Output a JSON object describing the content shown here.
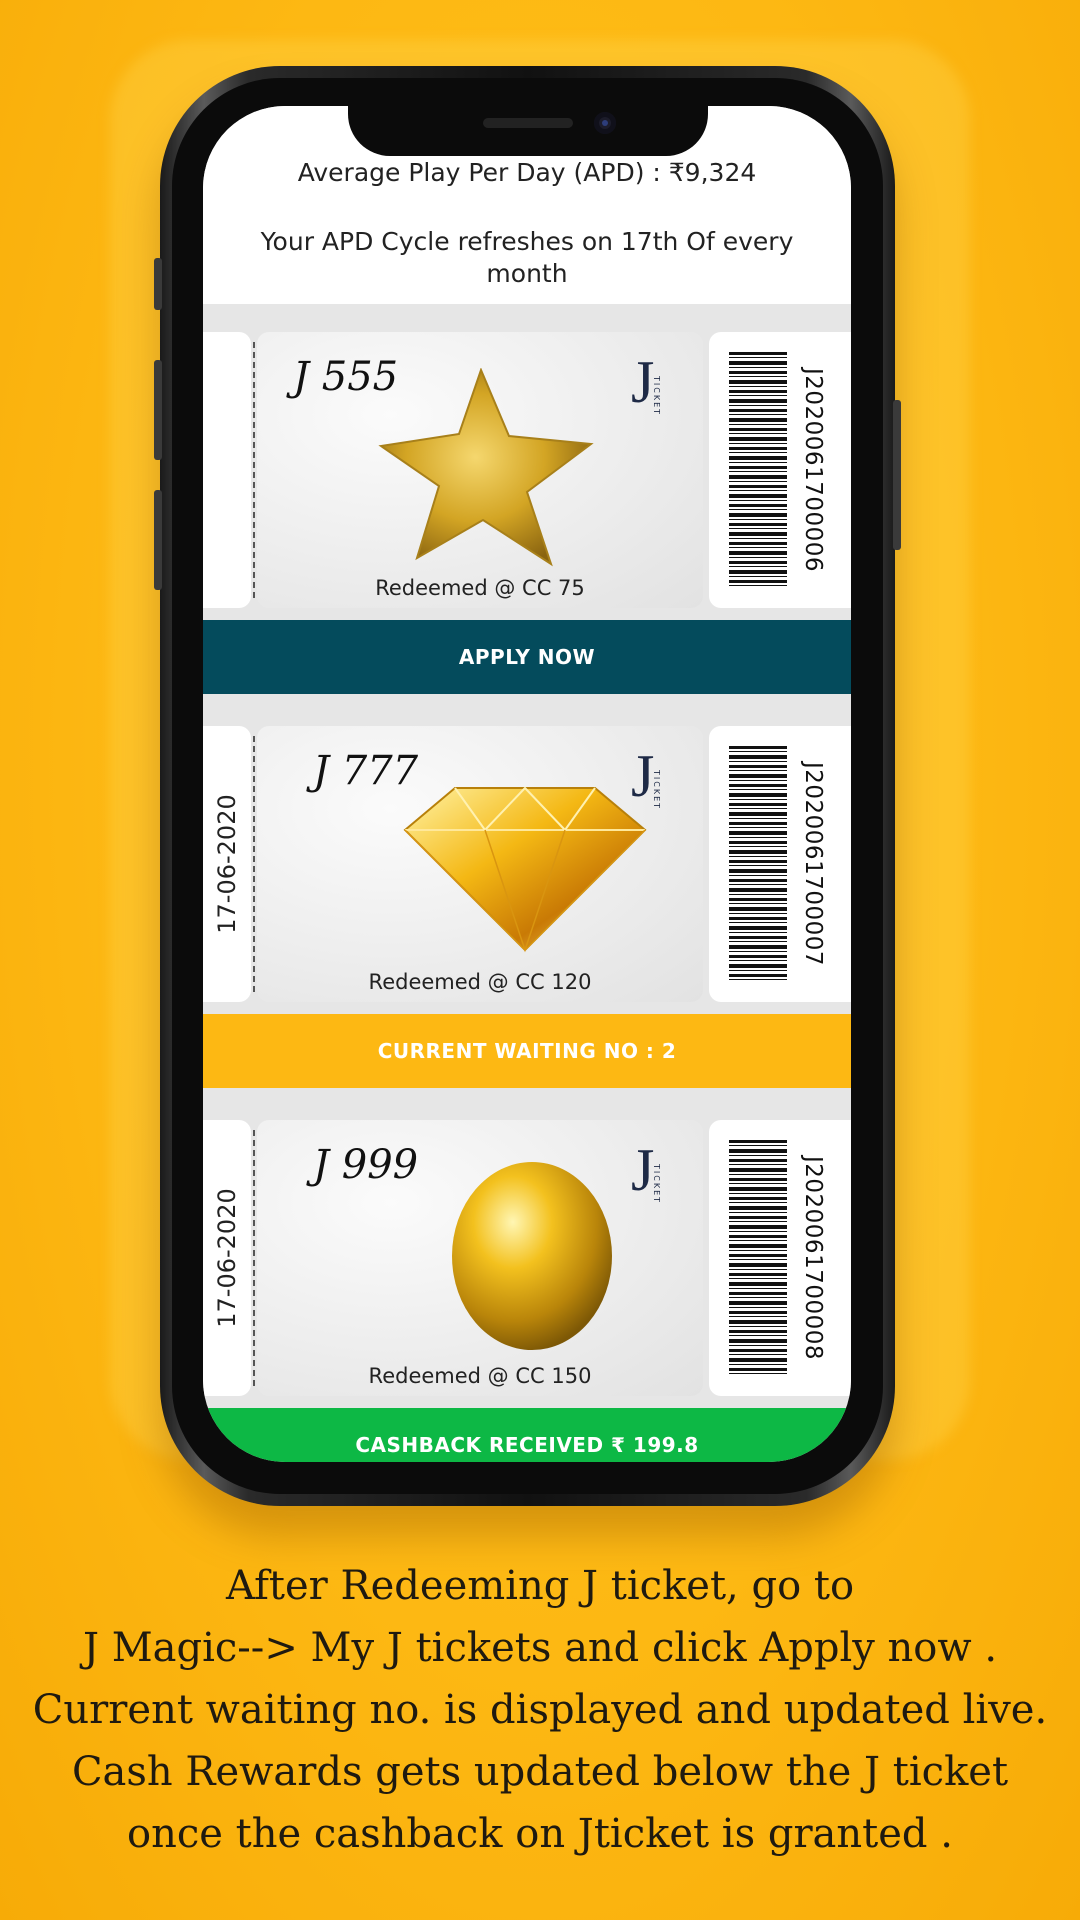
{
  "header": {
    "apd_text": "Average Play Per Day (APD) : ₹9,324",
    "refresh_text": "Your APD Cycle refreshes on 17th Of every month"
  },
  "tickets": [
    {
      "date": "",
      "title": "J 555",
      "reward_icon": "gold-star-icon",
      "redeemed": "Redeemed @ CC 75",
      "barcode": "J2020061700006",
      "action_label": "APPLY NOW",
      "action_color": "#044b5c"
    },
    {
      "date": "17-06-2020",
      "title": "J 777",
      "reward_icon": "gold-diamond-icon",
      "redeemed": "Redeemed @ CC 120",
      "barcode": "J2020061700007",
      "action_label": "CURRENT WAITING NO : 2",
      "action_color": "#fdb813"
    },
    {
      "date": "17-06-2020",
      "title": "J 999",
      "reward_icon": "gold-egg-icon",
      "redeemed": "Redeemed @ CC 150",
      "barcode": "J2020061700008",
      "action_label": "CASHBACK RECEIVED ₹ 199.8",
      "action_color": "#0db845"
    }
  ],
  "logo_letter": "J",
  "logo_sub": "TICKET",
  "caption": [
    "After Redeeming J ticket, go to",
    "J Magic--> My J tickets and click Apply now .",
    "Current waiting no. is displayed and updated live.",
    "Cash Rewards gets updated below the J ticket",
    "once the cashback on Jticket is granted ."
  ],
  "colors": {
    "background": "#fdb813",
    "logo_navy": "#1e2a46"
  }
}
